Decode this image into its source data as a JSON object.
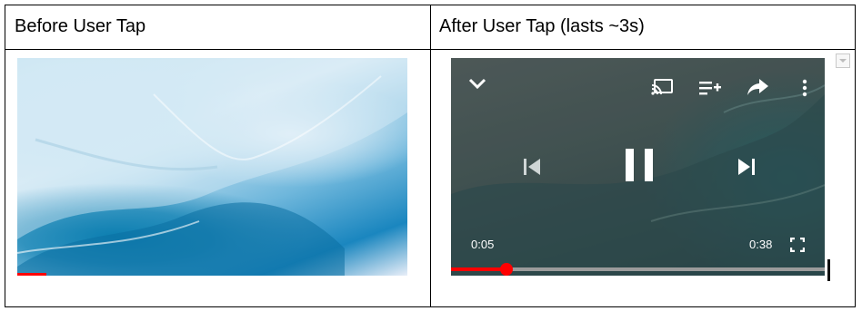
{
  "table": {
    "headers": [
      "Before User Tap",
      "After User Tap (lasts ~3s)"
    ]
  },
  "before_player": {
    "progress_fraction": 0.13
  },
  "after_player": {
    "current_time": "0:05",
    "duration": "0:38",
    "progress_fraction": 0.13,
    "icons": [
      "chevron-down-icon",
      "cast-icon",
      "add-to-queue-icon",
      "share-icon",
      "more-vert-icon",
      "previous-icon",
      "pause-icon",
      "next-icon",
      "fullscreen-icon"
    ]
  },
  "colors": {
    "progress": "#ff0000",
    "track": "#9b9b9b",
    "overlay_icons": "#ffffff"
  }
}
